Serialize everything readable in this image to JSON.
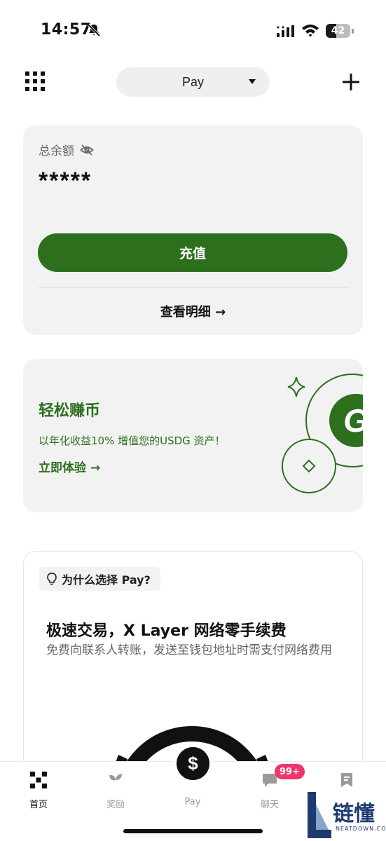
{
  "status_bar": {
    "time": "14:57",
    "battery_percent": "42",
    "battery_level": 0.42
  },
  "header": {
    "menu_icon": "grid-icon",
    "mode_selector_label": "Pay",
    "add_icon": "plus-icon"
  },
  "balance_card": {
    "label": "总余额",
    "hidden_icon": "eye-off-icon",
    "value": "*****",
    "recharge_button": "充值",
    "details_link": "查看明细 →"
  },
  "earn_card": {
    "title": "轻松赚币",
    "subtitle": "以年化收益10% 增值您的USDG 资产！",
    "cta": "立即体验 →",
    "logo_letter": "G"
  },
  "why_card": {
    "tag": "为什么选择 Pay?",
    "title": "极速交易，X Layer 网络零手续费",
    "description": "免费向联系人转账，发送至钱包地址时需支付网络费用"
  },
  "tab_bar": {
    "tabs": [
      {
        "label": "首页",
        "icon": "home-icon",
        "active": true
      },
      {
        "label": "奖励",
        "icon": "rewards-icon",
        "active": false
      },
      {
        "label": "Pay",
        "icon": "dollar-icon",
        "active": false
      },
      {
        "label": "聊天",
        "icon": "chat-icon",
        "active": false
      },
      {
        "label": "",
        "icon": "bookmark-icon",
        "active": false
      }
    ],
    "pay_symbol": "$",
    "chat_badge": "99+"
  },
  "watermark": {
    "text": "链懂",
    "sub": "NEATDOWN.COM"
  },
  "colors": {
    "accent_green": "#2c6f1c",
    "card_bg": "#f2f2f2",
    "badge_pink": "#f0356a"
  }
}
